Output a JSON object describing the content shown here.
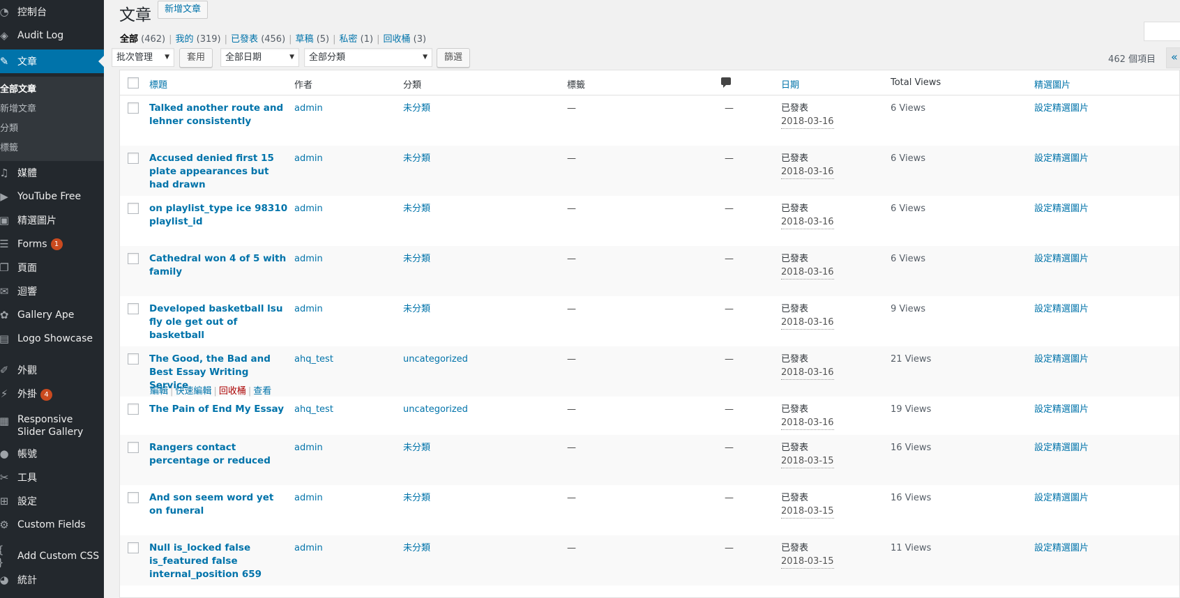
{
  "sidebar": {
    "items": [
      {
        "label": "控制台",
        "icon": "dashboard-icon",
        "glyph": "◔"
      },
      {
        "label": "Audit Log",
        "icon": "shield-icon",
        "glyph": "◈"
      },
      {
        "label": "文章",
        "icon": "pin-icon",
        "glyph": "✎",
        "active": true
      },
      {
        "label": "媒體",
        "icon": "media-icon",
        "glyph": "♫"
      },
      {
        "label": "YouTube Free",
        "icon": "youtube-icon",
        "glyph": "▶"
      },
      {
        "label": "精選圖片",
        "icon": "image-icon",
        "glyph": "▣"
      },
      {
        "label": "Forms",
        "icon": "forms-icon",
        "glyph": "☰",
        "badge": "1"
      },
      {
        "label": "頁面",
        "icon": "pages-icon",
        "glyph": "❐"
      },
      {
        "label": "迴響",
        "icon": "comments-icon",
        "glyph": "✉"
      },
      {
        "label": "Gallery Ape",
        "icon": "gallery-icon",
        "glyph": "✿"
      },
      {
        "label": "Logo Showcase",
        "icon": "logo-icon",
        "glyph": "▤"
      },
      {
        "label": "外觀",
        "icon": "brush-icon",
        "glyph": "✐"
      },
      {
        "label": "外掛",
        "icon": "plugin-icon",
        "glyph": "⚡",
        "badge": "4"
      },
      {
        "label": "Responsive Slider Gallery",
        "icon": "slider-icon",
        "glyph": "▦"
      },
      {
        "label": "帳號",
        "icon": "user-icon",
        "glyph": "●"
      },
      {
        "label": "工具",
        "icon": "wrench-icon",
        "glyph": "✂"
      },
      {
        "label": "設定",
        "icon": "settings-icon",
        "glyph": "⊞"
      },
      {
        "label": "Custom Fields",
        "icon": "gear-icon",
        "glyph": "⚙"
      },
      {
        "label": "Add Custom CSS",
        "icon": "braces-icon",
        "glyph": "{ }"
      },
      {
        "label": "統計",
        "icon": "chart-icon",
        "glyph": "◕"
      }
    ],
    "submenu": [
      "全部文章",
      "新增文章",
      "分類",
      "標籤"
    ]
  },
  "header": {
    "title": "文章",
    "add_new": "新增文章"
  },
  "views": [
    {
      "label": "全部",
      "count": "(462)"
    },
    {
      "label": "我的",
      "count": "(319)"
    },
    {
      "label": "已發表",
      "count": "(456)"
    },
    {
      "label": "草稿",
      "count": "(5)"
    },
    {
      "label": "私密",
      "count": "(1)"
    },
    {
      "label": "回收桶",
      "count": "(3)"
    }
  ],
  "filters": {
    "bulk_action": "批次管理",
    "apply": "套用",
    "date": "全部日期",
    "category": "全部分類",
    "filter": "篩選",
    "item_count": "462 個項目",
    "prev": "«"
  },
  "columns": {
    "title": "標題",
    "author": "作者",
    "categories": "分類",
    "tags": "標籤",
    "date": "日期",
    "views": "Total Views",
    "featured": "精選圖片"
  },
  "row_actions": {
    "edit": "編輯",
    "quick_edit": "快速編輯",
    "trash": "回收桶",
    "view": "查看"
  },
  "posts": [
    {
      "title": "Talked another route and lehner consistently",
      "author": "admin",
      "category": "未分類",
      "tags": "—",
      "comments": "—",
      "status": "已發表",
      "date": "2018-03-16",
      "views": "6 Views",
      "featured": "設定精選圖片"
    },
    {
      "title": "Accused denied first 15 plate appearances but had drawn",
      "author": "admin",
      "category": "未分類",
      "tags": "—",
      "comments": "—",
      "status": "已發表",
      "date": "2018-03-16",
      "views": "6 Views",
      "featured": "設定精選圖片"
    },
    {
      "title": "on playlist_type ice 98310 playlist_id",
      "author": "admin",
      "category": "未分類",
      "tags": "—",
      "comments": "—",
      "status": "已發表",
      "date": "2018-03-16",
      "views": "6 Views",
      "featured": "設定精選圖片"
    },
    {
      "title": "Cathedral won 4 of 5 with family",
      "author": "admin",
      "category": "未分類",
      "tags": "—",
      "comments": "—",
      "status": "已發表",
      "date": "2018-03-16",
      "views": "6 Views",
      "featured": "設定精選圖片"
    },
    {
      "title": "Developed basketball lsu fly ole get out of basketball",
      "author": "admin",
      "category": "未分類",
      "tags": "—",
      "comments": "—",
      "status": "已發表",
      "date": "2018-03-16",
      "views": "9 Views",
      "featured": "設定精選圖片"
    },
    {
      "title": "The Good, the Bad and Best Essay Writing Service",
      "author": "ahq_test",
      "category": "uncategorized",
      "tags": "—",
      "comments": "—",
      "status": "已發表",
      "date": "2018-03-16",
      "views": "21 Views",
      "featured": "設定精選圖片",
      "hover": true
    },
    {
      "title": "The Pain of End My Essay",
      "author": "ahq_test",
      "category": "uncategorized",
      "tags": "—",
      "comments": "—",
      "status": "已發表",
      "date": "2018-03-16",
      "views": "19 Views",
      "featured": "設定精選圖片"
    },
    {
      "title": "Rangers contact percentage or reduced",
      "author": "admin",
      "category": "未分類",
      "tags": "—",
      "comments": "—",
      "status": "已發表",
      "date": "2018-03-15",
      "views": "16 Views",
      "featured": "設定精選圖片"
    },
    {
      "title": "And son seem word yet on funeral",
      "author": "admin",
      "category": "未分類",
      "tags": "—",
      "comments": "—",
      "status": "已發表",
      "date": "2018-03-15",
      "views": "16 Views",
      "featured": "設定精選圖片"
    },
    {
      "title": "Null is_locked false is_featured false internal_position 659",
      "author": "admin",
      "category": "未分類",
      "tags": "—",
      "comments": "—",
      "status": "已發表",
      "date": "2018-03-15",
      "views": "11 Views",
      "featured": "設定精選圖片"
    }
  ]
}
